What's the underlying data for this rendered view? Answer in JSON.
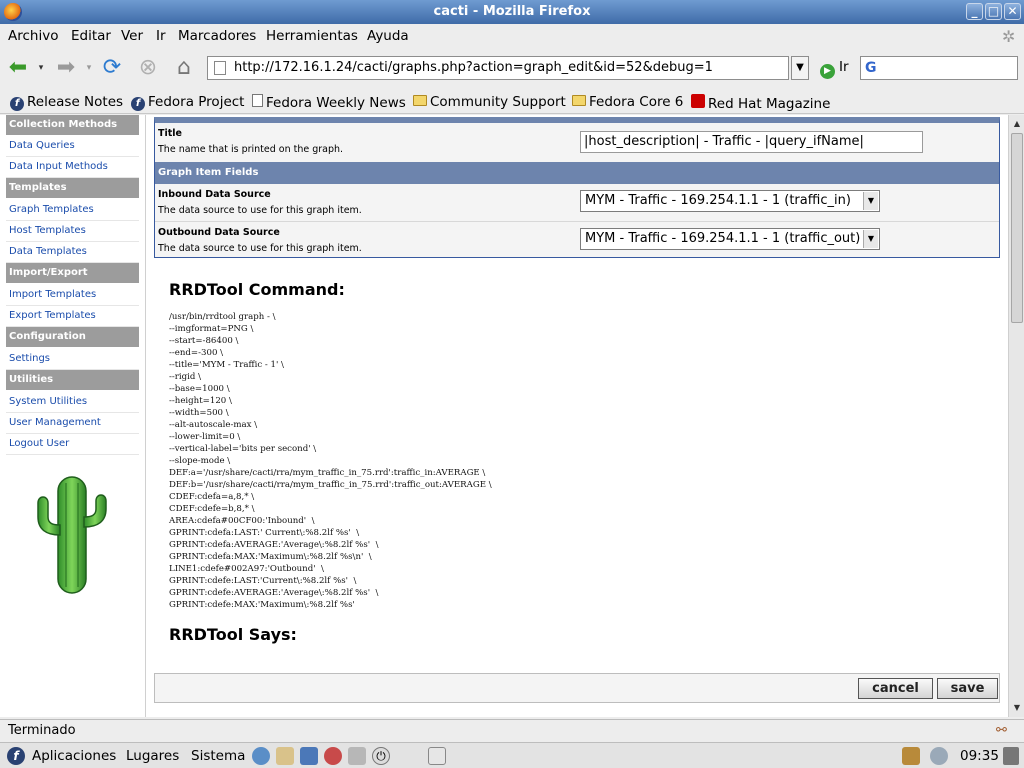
{
  "window": {
    "title": "cacti - Mozilla Firefox"
  },
  "menu": [
    "Archivo",
    "Editar",
    "Ver",
    "Ir",
    "Marcadores",
    "Herramientas",
    "Ayuda"
  ],
  "nav": {
    "url": "http://172.16.1.24/cacti/graphs.php?action=graph_edit&id=52&debug=1",
    "go_label": "Ir",
    "search_value": ""
  },
  "bookmarks": [
    "Release Notes",
    "Fedora Project",
    "Fedora Weekly News",
    "Community Support",
    "Fedora Core 6",
    "Red Hat Magazine"
  ],
  "sidebar": {
    "sections": [
      {
        "header": "Collection Methods",
        "items": [
          "Data Queries",
          "Data Input Methods"
        ]
      },
      {
        "header": "Templates",
        "items": [
          "Graph Templates",
          "Host Templates",
          "Data Templates"
        ]
      },
      {
        "header": "Import/Export",
        "items": [
          "Import Templates",
          "Export Templates"
        ]
      },
      {
        "header": "Configuration",
        "items": [
          "Settings"
        ]
      },
      {
        "header": "Utilities",
        "items": [
          "System Utilities",
          "User Management",
          "Logout User"
        ]
      }
    ]
  },
  "form": {
    "title_label": "Title",
    "title_desc": "The name that is printed on the graph.",
    "title_value": "|host_description| - Traffic - |query_ifName|",
    "section_label": "Graph Item Fields",
    "inbound_label": "Inbound Data Source",
    "inbound_desc": "The data source to use for this graph item.",
    "inbound_value": "MYM - Traffic - 169.254.1.1 - 1 (traffic_in)",
    "outbound_label": "Outbound Data Source",
    "outbound_desc": "The data source to use for this graph item.",
    "outbound_value": "MYM - Traffic - 169.254.1.1 - 1 (traffic_out)"
  },
  "rrd": {
    "command_title": "RRDTool Command:",
    "command": "/usr/bin/rrdtool graph - \\\n--imgformat=PNG \\\n--start=-86400 \\\n--end=-300 \\\n--title='MYM - Traffic - 1' \\\n--rigid \\\n--base=1000 \\\n--height=120 \\\n--width=500 \\\n--alt-autoscale-max \\\n--lower-limit=0 \\\n--vertical-label='bits per second' \\\n--slope-mode \\\nDEF:a='/usr/share/cacti/rra/mym_traffic_in_75.rrd':traffic_in:AVERAGE \\\nDEF:b='/usr/share/cacti/rra/mym_traffic_in_75.rrd':traffic_out:AVERAGE \\\nCDEF:cdefa=a,8,* \\\nCDEF:cdefe=b,8,* \\\nAREA:cdefa#00CF00:'Inbound'  \\\nGPRINT:cdefa:LAST:' Current\\:%8.2lf %s'  \\\nGPRINT:cdefa:AVERAGE:'Average\\:%8.2lf %s'  \\\nGPRINT:cdefa:MAX:'Maximum\\:%8.2lf %s\\n'  \\\nLINE1:cdefe#002A97:'Outbound'  \\\nGPRINT:cdefe:LAST:'Current\\:%8.2lf %s'  \\\nGPRINT:cdefe:AVERAGE:'Average\\:%8.2lf %s'  \\\nGPRINT:cdefe:MAX:'Maximum\\:%8.2lf %s'",
    "says_title": "RRDTool Says:"
  },
  "buttons": {
    "cancel": "cancel",
    "save": "save"
  },
  "status": {
    "text": "Terminado"
  },
  "panel": {
    "apps": "Aplicaciones",
    "places": "Lugares",
    "system": "Sistema",
    "clock": "09:35"
  },
  "colors": {
    "titlebar": "#3f6ba8",
    "section_bar": "#6d84ad",
    "sidebar_header": "#9c9c9c",
    "link": "#1a4cab"
  }
}
